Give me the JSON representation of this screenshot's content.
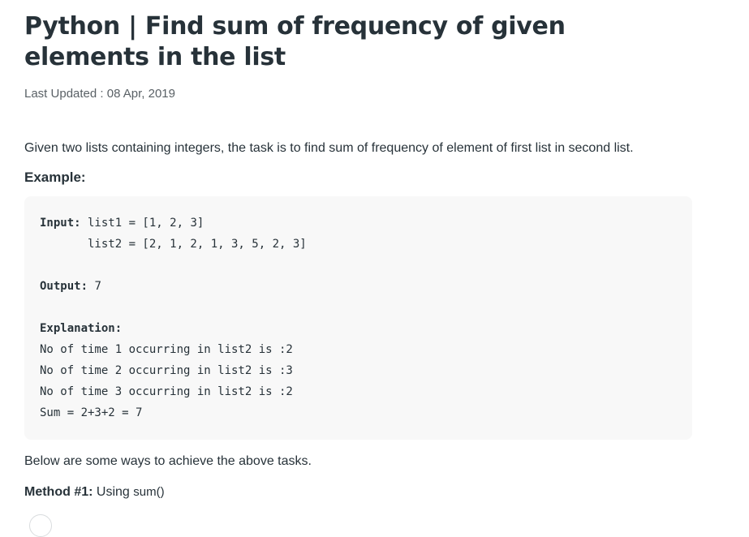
{
  "article": {
    "title": "Python | Find sum of frequency of given elements in the list",
    "last_updated": "Last Updated : 08 Apr, 2019",
    "intro": "Given two lists containing integers, the task is to find sum of frequency of element of first list in second list.",
    "example_heading": "Example:",
    "example": {
      "input_label": "Input:",
      "input_line1": " list1 = [1, 2, 3]",
      "input_line2": "       list2 = [2, 1, 2, 1, 3, 5, 2, 3]",
      "output_label": "Output:",
      "output_value": " 7",
      "explanation_label": "Explanation:",
      "explanation_lines": [
        "No of time 1 occurring in list2 is :2",
        "No of time 2 occurring in list2 is :3",
        "No of time 3 occurring in list2 is :2",
        "Sum = 2+3+2 = 7"
      ]
    },
    "below_text": "Below are some ways to achieve the above tasks.",
    "method_label": "Method #1:",
    "method_text": " Using ",
    "method_code": "sum()"
  }
}
